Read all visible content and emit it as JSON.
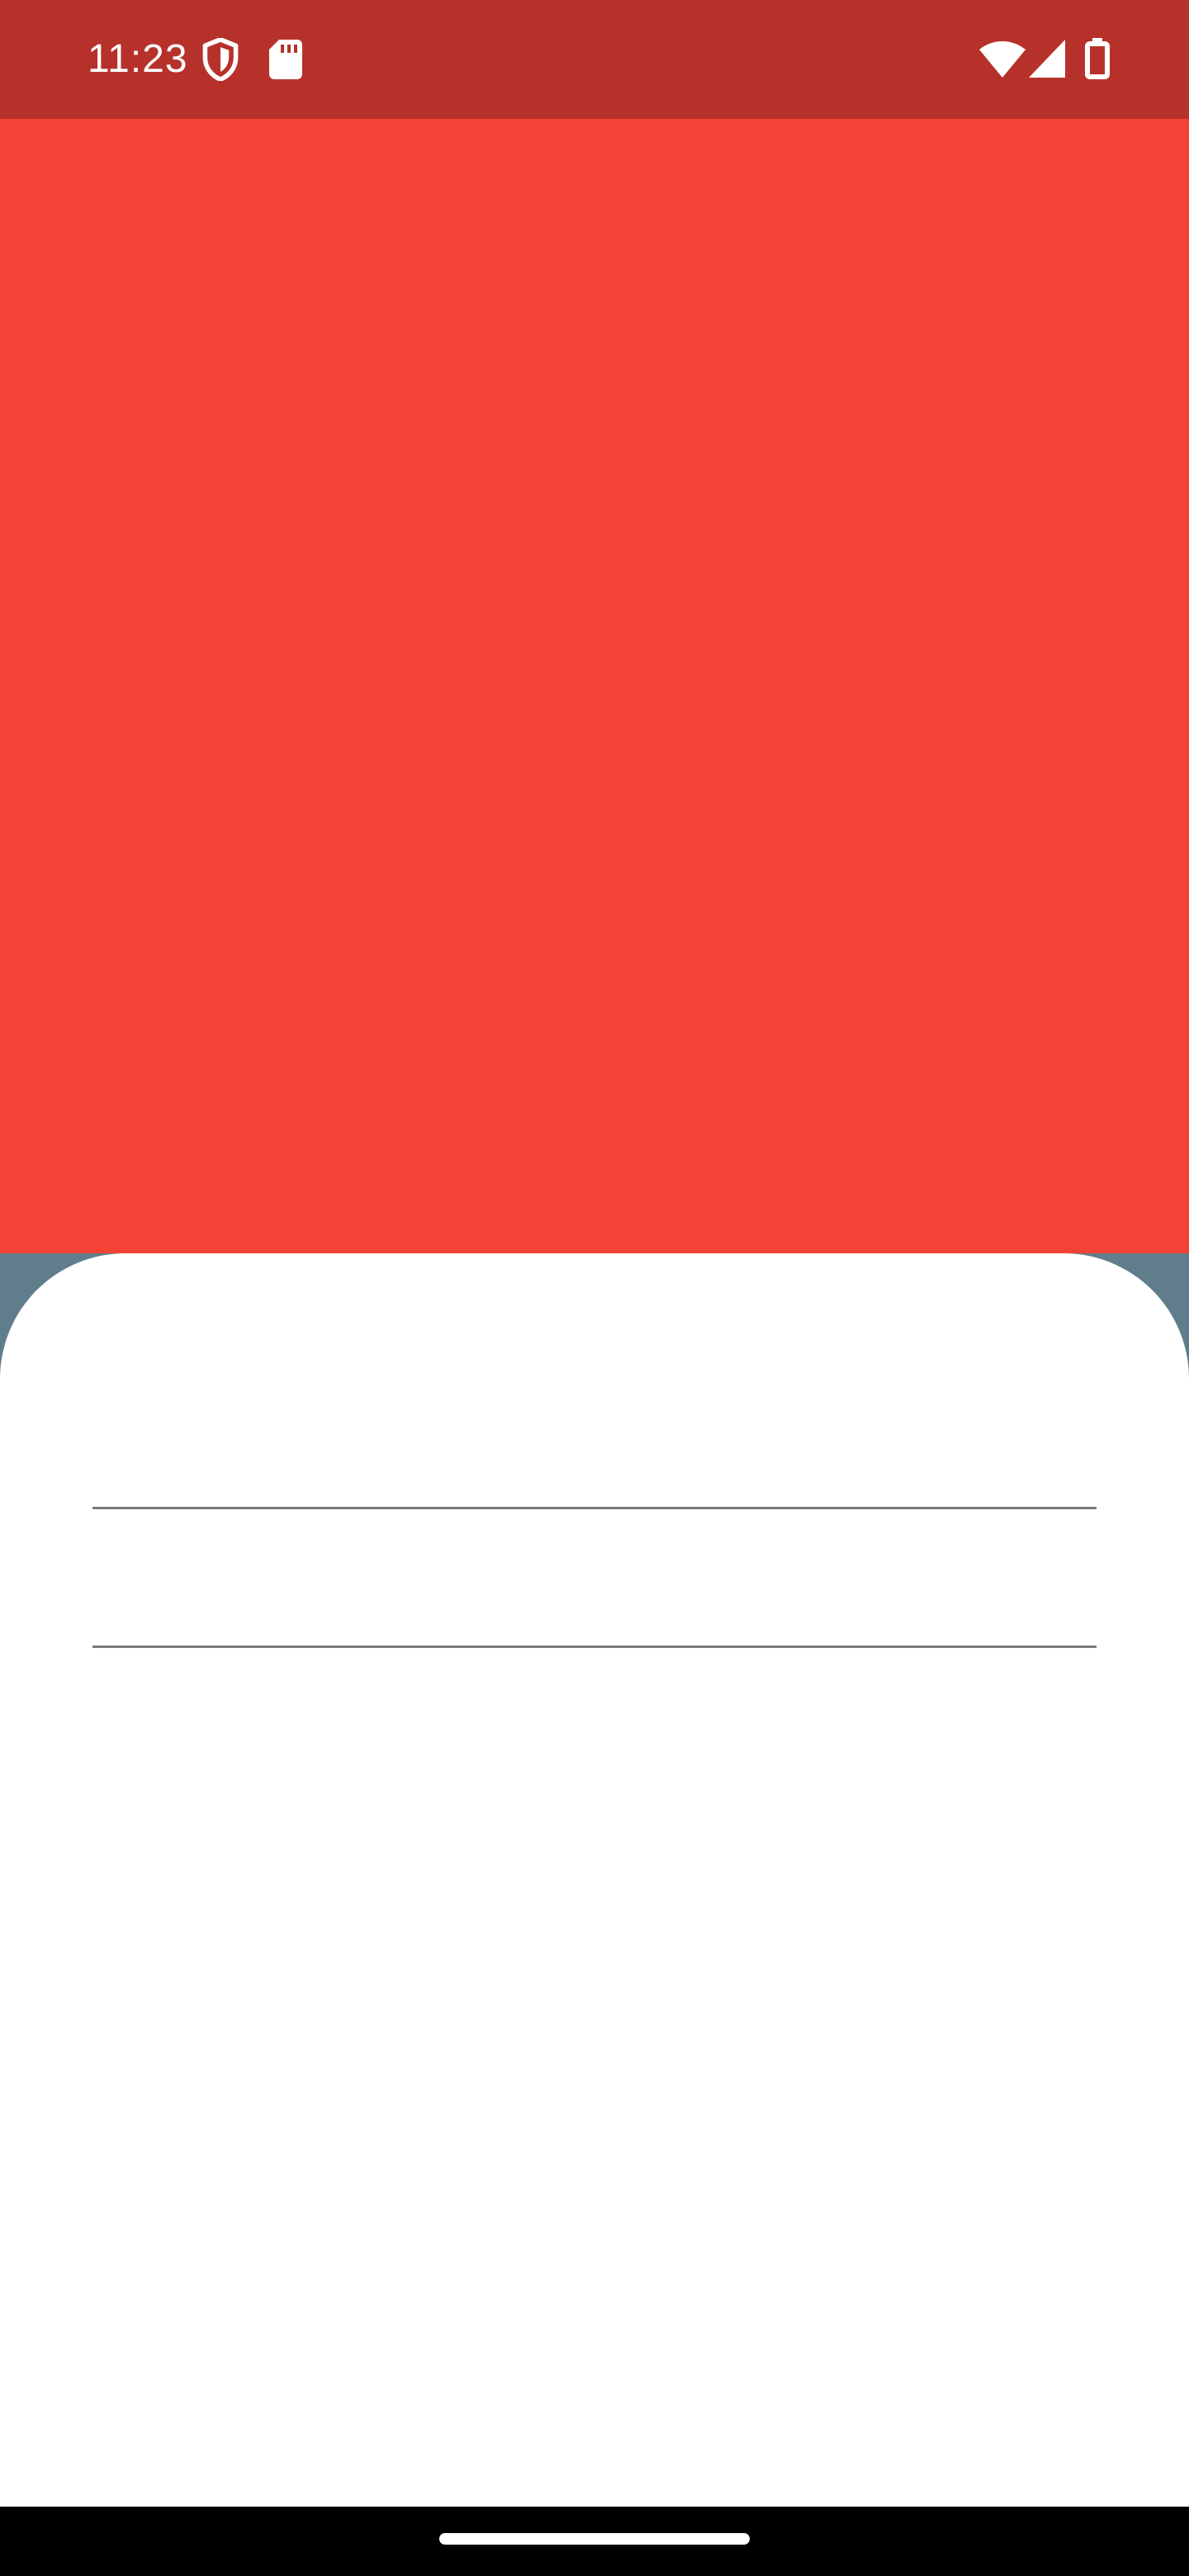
{
  "status_bar": {
    "time": "11:23",
    "icons": [
      "shield-icon",
      "sd-card-icon",
      "wifi-icon",
      "signal-icon",
      "battery-icon"
    ],
    "background_color": "#b7312b"
  },
  "hero": {
    "background_color": "#f44336"
  },
  "sheet": {
    "background_color": "#ffffff",
    "backdrop_color": "#607d8b",
    "fields": [
      {
        "value": "",
        "placeholder": ""
      },
      {
        "value": "",
        "placeholder": ""
      }
    ]
  },
  "navigation_bar": {
    "background_color": "#000000",
    "handle": "home-handle"
  }
}
